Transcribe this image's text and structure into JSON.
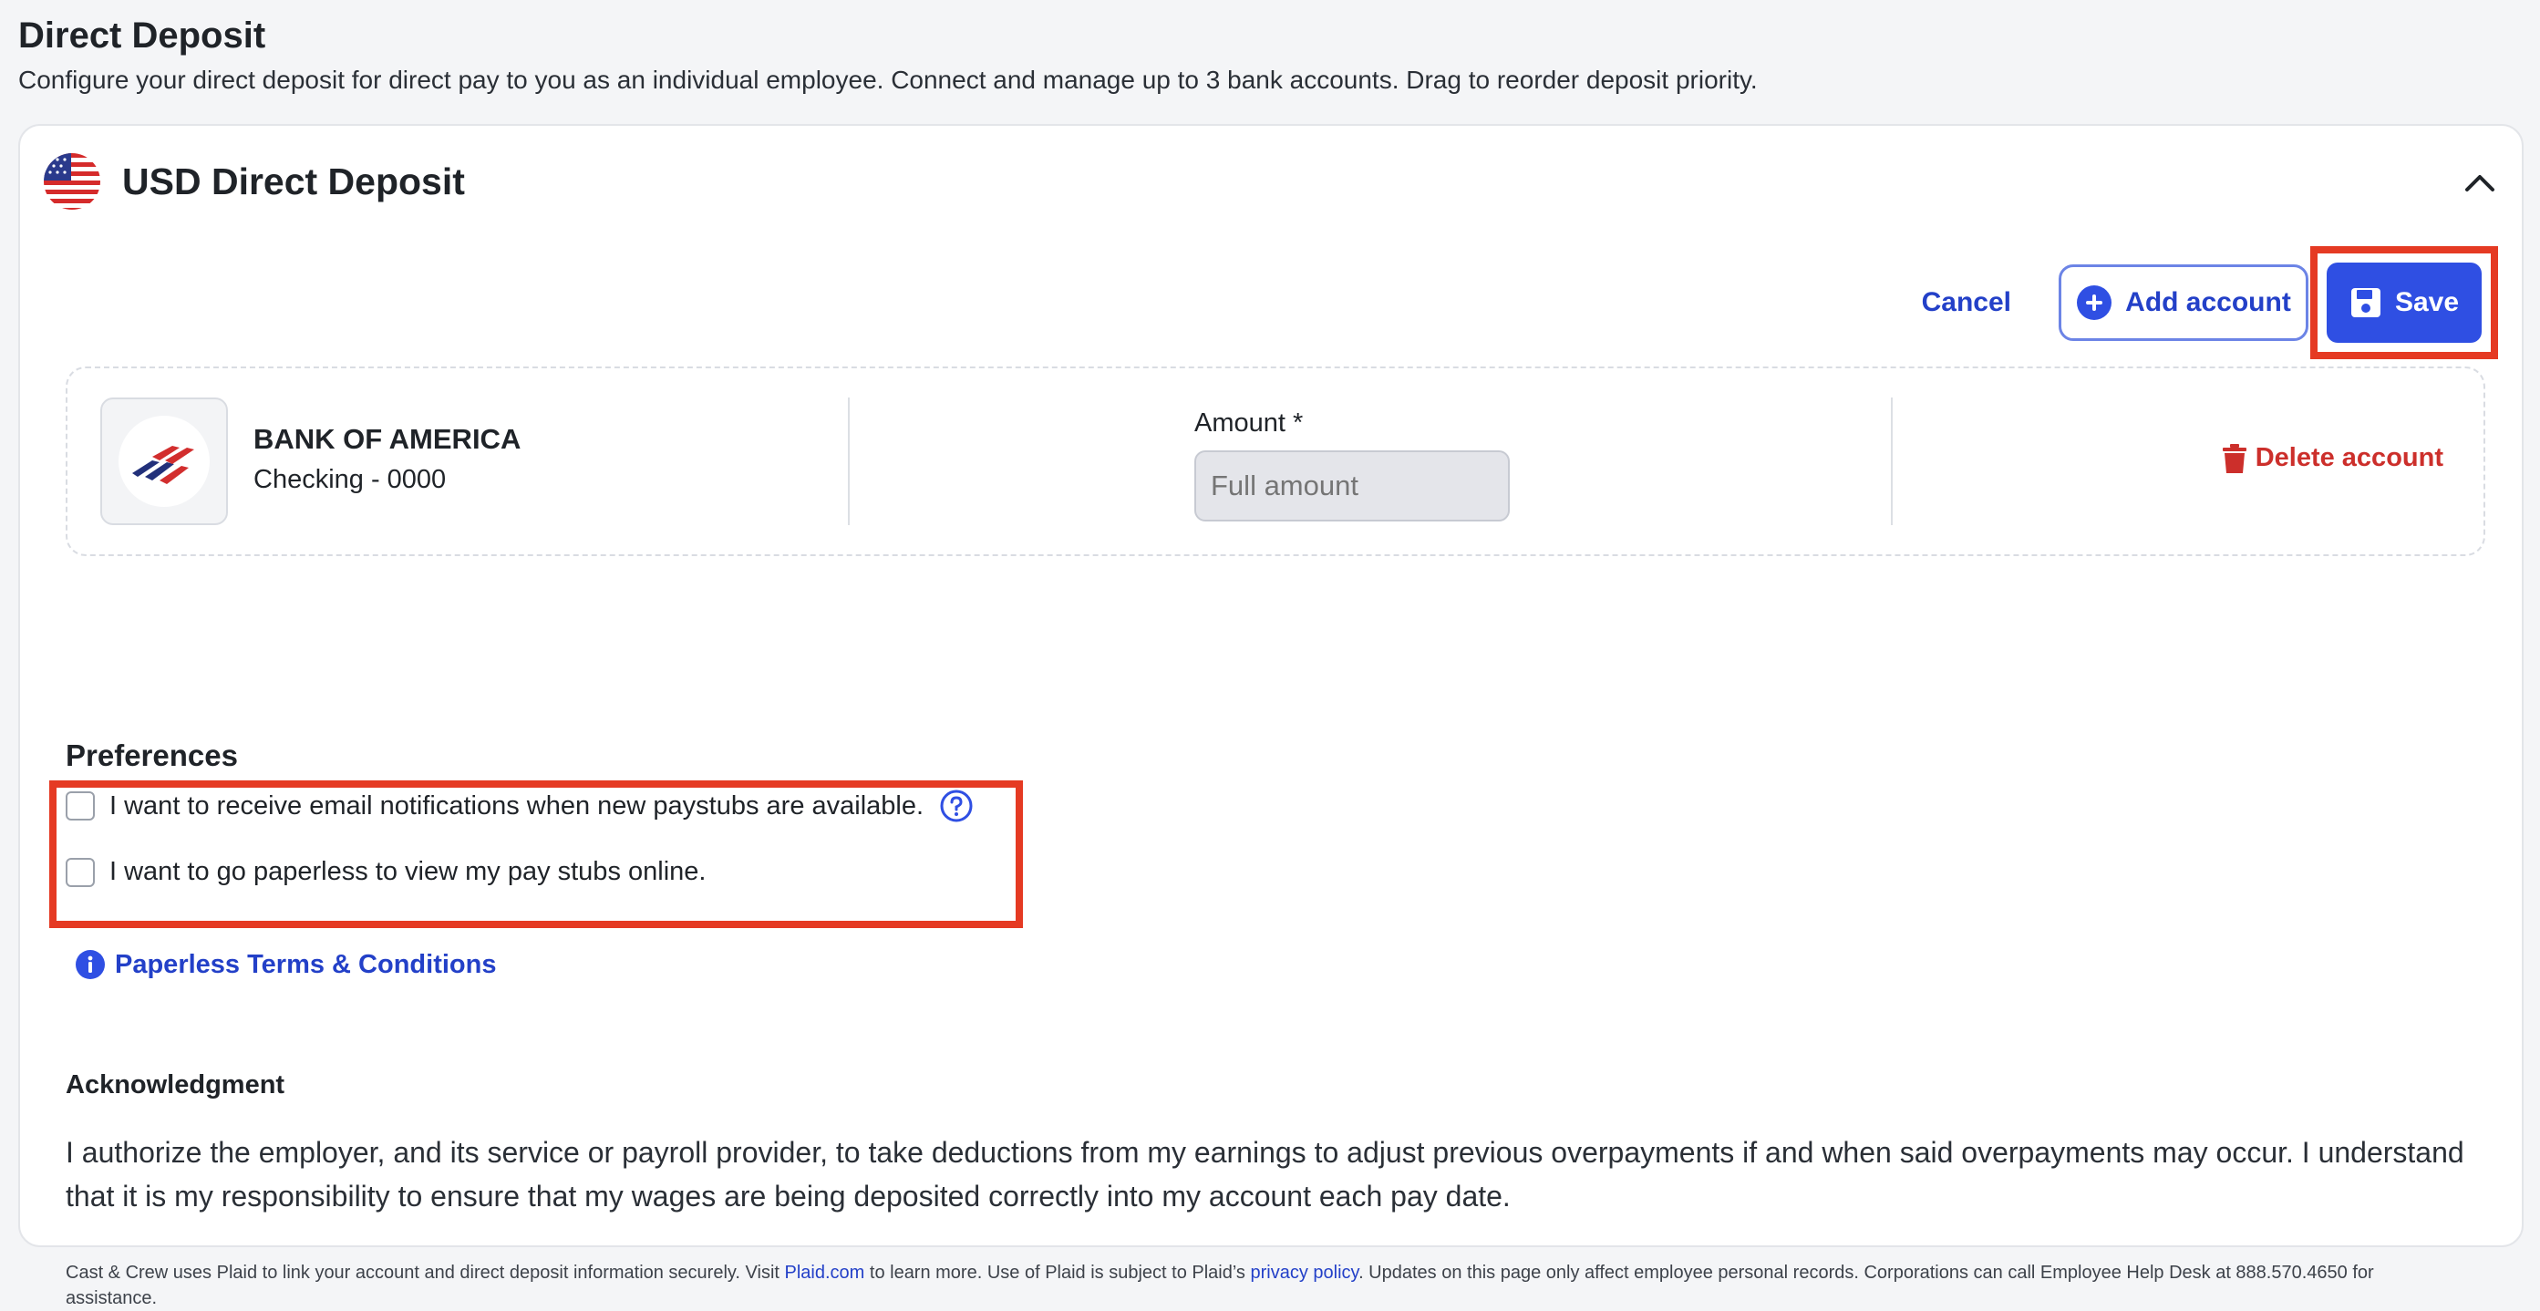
{
  "page": {
    "title": "Direct Deposit",
    "subtitle": "Configure your direct deposit for direct pay to you as an individual employee. Connect and manage up to 3 bank accounts. Drag to reorder deposit priority."
  },
  "card": {
    "title": "USD Direct Deposit",
    "flag_icon": "us-flag-icon",
    "collapse_icon": "chevron-up-icon"
  },
  "actions": {
    "cancel_label": "Cancel",
    "add_label": "Add account",
    "save_label": "Save"
  },
  "account": {
    "bank_name": "BANK OF AMERICA",
    "account_label": "Checking - 0000",
    "amount_label": "Amount *",
    "amount_placeholder": "Full amount",
    "delete_label": "Delete account"
  },
  "preferences": {
    "title": "Preferences",
    "email_label": "I want to receive email notifications when new paystubs are available.",
    "paperless_label": "I want to go paperless to view my pay stubs online.",
    "terms_label": "Paperless Terms & Conditions"
  },
  "acknowledgment": {
    "title": "Acknowledgment",
    "text": "I authorize the employer, and its service or payroll provider, to take deductions from my earnings to adjust previous overpayments if and when said overpayments may occur. I understand that it is my responsibility to ensure that my wages are being deposited correctly into my account each pay date."
  },
  "footnote": {
    "part1": "Cast & Crew uses Plaid to link your account and direct deposit information securely. Visit ",
    "link1": "Plaid.com",
    "part2": " to learn more. Use of Plaid is subject to Plaid’s ",
    "link2": "privacy policy",
    "part3": ". Updates on this page only affect employee personal records. Corporations can call Employee Help Desk at 888.570.4650 for assistance."
  },
  "colors": {
    "primary": "#2f4fe3",
    "link": "#2340c8",
    "danger": "#cc2f2b",
    "highlight": "#e53a23"
  }
}
